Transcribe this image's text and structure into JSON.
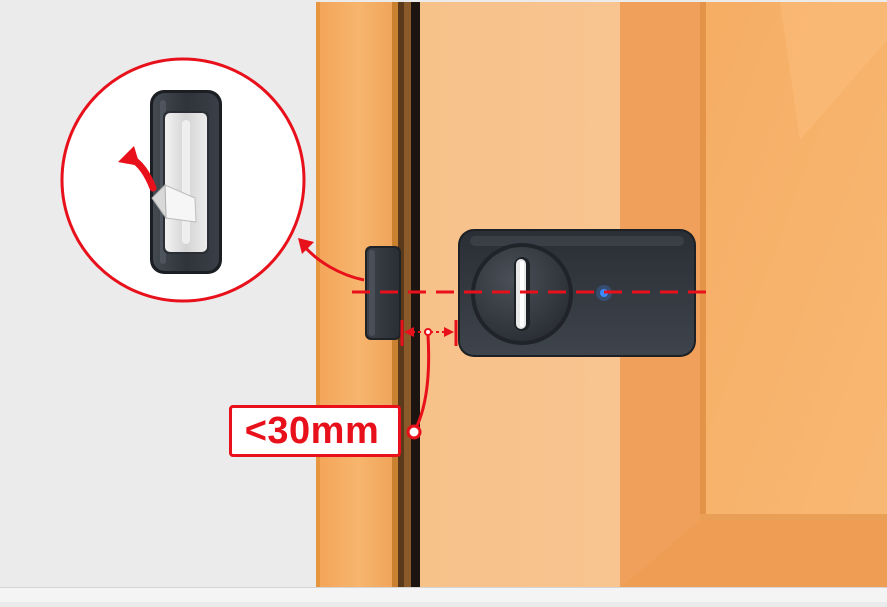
{
  "measurement": {
    "label": "<30mm"
  },
  "colors": {
    "accent_red": "#e8101a",
    "door_wood": "#f7b970",
    "door_frame": "#f2a55a",
    "wall": "#ebebeb",
    "device_body": "#2f343b",
    "led": "#3b8cff"
  },
  "icons": {
    "magnified_sensor": "door-sensor-peel-adhesive-icon",
    "rotate_arrow": "red-rotate-arrow-icon",
    "pointer_arrow": "curved-pointer-arrow-icon"
  }
}
